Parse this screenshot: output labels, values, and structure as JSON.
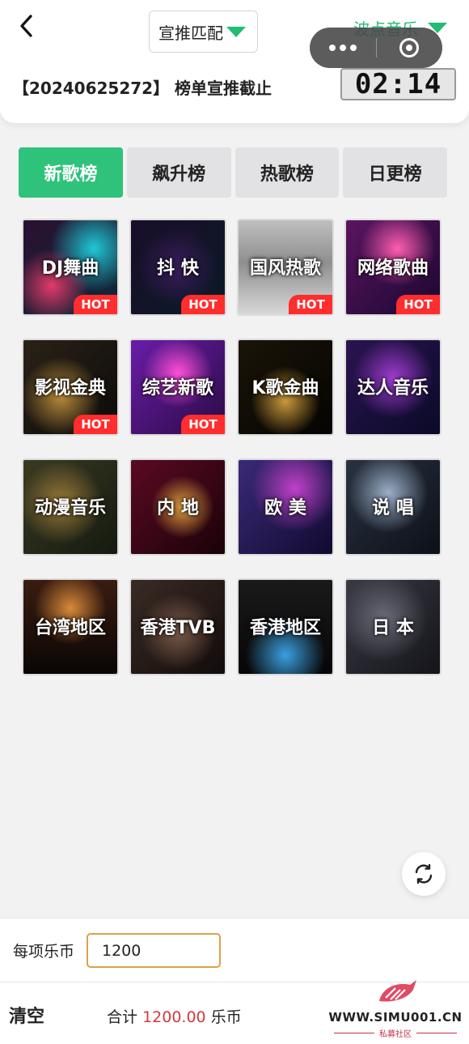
{
  "header": {
    "match_select": "宣推匹配",
    "platform": "波点音乐"
  },
  "notice": {
    "text": "【20240625272】 榜单宣推截止",
    "countdown": "02:14"
  },
  "tabs": [
    {
      "label": "新歌榜",
      "active": true
    },
    {
      "label": "飙升榜",
      "active": false
    },
    {
      "label": "热歌榜",
      "active": false
    },
    {
      "label": "日更榜",
      "active": false
    }
  ],
  "categories": [
    {
      "name": "DJ舞曲",
      "hot": "HOT"
    },
    {
      "name": "抖 快",
      "hot": "HOT"
    },
    {
      "name": "国风热歌",
      "hot": "HOT"
    },
    {
      "name": "网络歌曲",
      "hot": "HOT"
    },
    {
      "name": "影视金典",
      "hot": "HOT"
    },
    {
      "name": "综艺新歌",
      "hot": "HOT"
    },
    {
      "name": "K歌金曲",
      "hot": ""
    },
    {
      "name": "达人音乐",
      "hot": ""
    },
    {
      "name": "动漫音乐",
      "hot": ""
    },
    {
      "name": "内 地",
      "hot": ""
    },
    {
      "name": "欧 美",
      "hot": ""
    },
    {
      "name": "说 唱",
      "hot": ""
    },
    {
      "name": "台湾地区",
      "hot": ""
    },
    {
      "name": "香港TVB",
      "hot": ""
    },
    {
      "name": "香港地区",
      "hot": ""
    },
    {
      "name": "日 本",
      "hot": ""
    }
  ],
  "coin": {
    "label": "每项乐币",
    "value": "1200"
  },
  "footer": {
    "clear": "清空",
    "total_prefix": "合计",
    "total_amount": "1200.00",
    "total_unit": "乐币"
  },
  "watermark": {
    "url": "WWW.SIMU001.CN",
    "sub": "私募社区"
  },
  "colors": {
    "accent_green": "#2fc27b",
    "hot_red": "#ff2d2d",
    "amount_red": "#d23b3b",
    "input_border": "#dba24a"
  }
}
